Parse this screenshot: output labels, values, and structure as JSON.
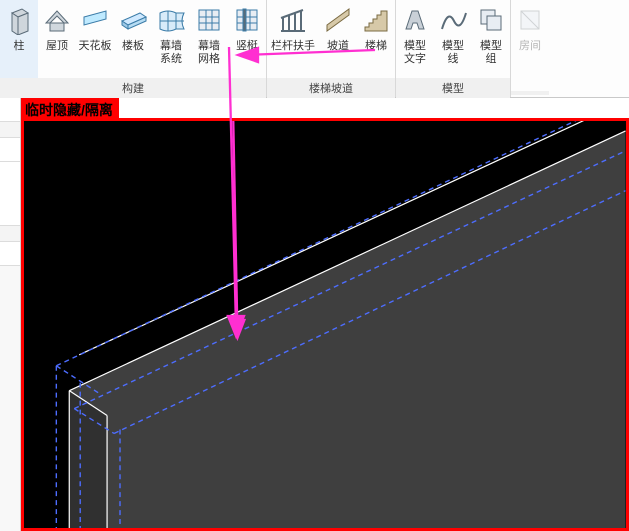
{
  "ribbon": {
    "groups": [
      {
        "title": "构建",
        "buttons": [
          {
            "name": "column",
            "label": "柱"
          },
          {
            "name": "roof",
            "label": "屋顶"
          },
          {
            "name": "ceiling",
            "label": "天花板"
          },
          {
            "name": "floor",
            "label": "楼板"
          },
          {
            "name": "curtain-system",
            "label": "幕墙\n系统"
          },
          {
            "name": "curtain-grid",
            "label": "幕墙\n网格"
          },
          {
            "name": "mullion",
            "label": "竖梃"
          }
        ]
      },
      {
        "title": "楼梯坡道",
        "buttons": [
          {
            "name": "railing",
            "label": "栏杆扶手"
          },
          {
            "name": "ramp",
            "label": "坡道"
          },
          {
            "name": "stair",
            "label": "楼梯"
          }
        ]
      },
      {
        "title": "模型",
        "buttons": [
          {
            "name": "model-text",
            "label": "模型\n文字"
          },
          {
            "name": "model-line",
            "label": "模型\n线"
          },
          {
            "name": "model-group",
            "label": "模型\n组"
          }
        ]
      },
      {
        "title": "",
        "buttons": [
          {
            "name": "room",
            "label": "房间",
            "dim": true
          }
        ]
      }
    ]
  },
  "view": {
    "isolation_banner": "临时隐藏/隔离"
  }
}
